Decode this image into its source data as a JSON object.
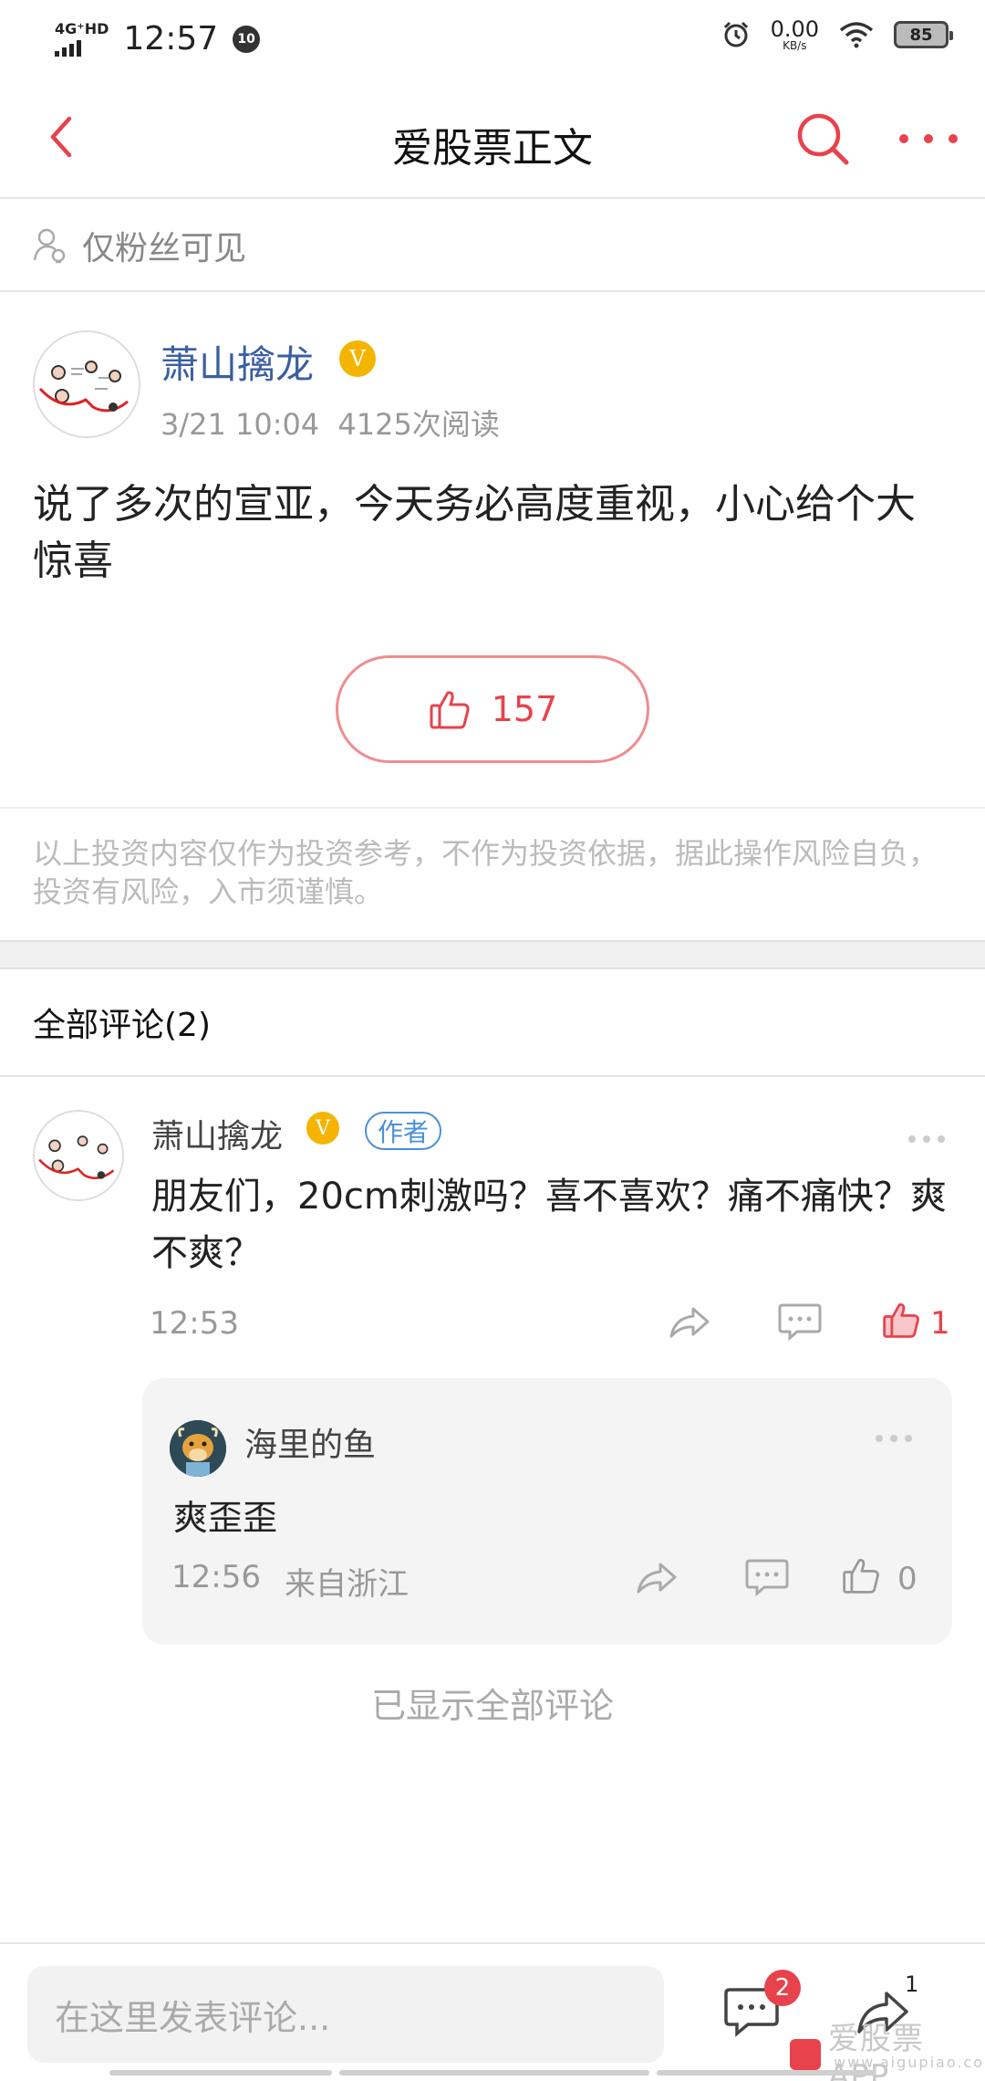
{
  "status_bar": {
    "network": "4G⁺HD",
    "time": "12:57",
    "notification_count": "10",
    "speed_value": "0.00",
    "speed_unit": "KB/s",
    "battery": "85"
  },
  "nav": {
    "title": "爱股票正文",
    "back_icon": "chevron-left-icon",
    "search_icon": "search-icon",
    "more_icon": "more-dots-icon"
  },
  "visibility": {
    "label": "仅粉丝可见"
  },
  "post": {
    "author": "萧山擒龙",
    "verified_badge": "V",
    "date": "3/21 10:04",
    "reads": "4125次阅读",
    "content": "说了多次的宣亚，今天务必高度重视，小心给个大惊喜",
    "likes": "157"
  },
  "disclaimer": "以上投资内容仅作为投资参考，不作为投资依据，据此操作风险自负，投资有风险，入市须谨慎。",
  "comments_section": {
    "header": "全部评论(2)",
    "comments": [
      {
        "author": "萧山擒龙",
        "badge": "V",
        "tag": "作者",
        "text": "朋友们，20cm刺激吗？喜不喜欢？痛不痛快？爽不爽？",
        "time": "12:53",
        "likes": "1",
        "liked": true,
        "replies": [
          {
            "author": "海里的鱼",
            "text": "爽歪歪",
            "time": "12:56",
            "location": "来自浙江",
            "likes": "0"
          }
        ]
      }
    ],
    "footer": "已显示全部评论"
  },
  "bottom_bar": {
    "input_placeholder": "在这里发表评论...",
    "comment_badge": "2",
    "share_count": "1"
  },
  "watermark": {
    "text": "爱股票APP",
    "url": "www.aigupiao.com"
  },
  "colors": {
    "accent": "#e8424c",
    "author_name": "#3a5fa0",
    "verified": "#f4b400",
    "author_tag": "#4a90d9"
  }
}
